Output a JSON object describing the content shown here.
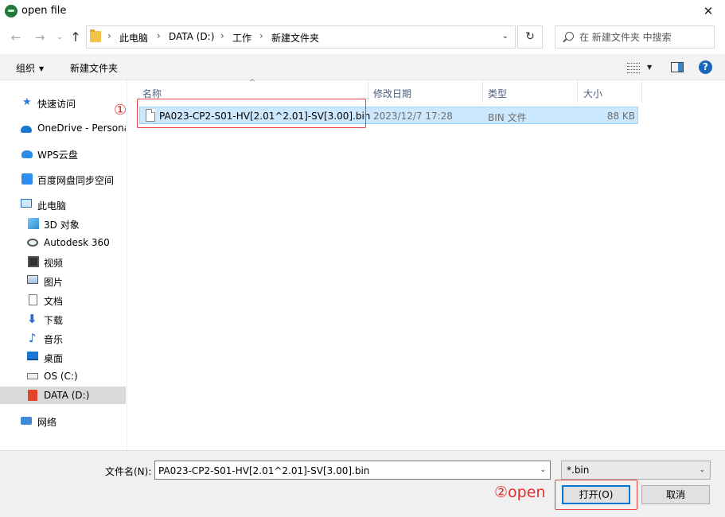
{
  "window": {
    "title": "open file"
  },
  "nav": {
    "back": "←",
    "forward": "→",
    "recent": "⌄",
    "up": "↑"
  },
  "address": {
    "crumbs": [
      "此电脑",
      "DATA (D:)",
      "工作",
      "新建文件夹"
    ],
    "sep": "›",
    "dropdown": "⌄"
  },
  "refresh": "↻",
  "search": {
    "placeholder": "在 新建文件夹 中搜索"
  },
  "toolbar": {
    "organize": "组织",
    "organize_caret": "▼",
    "new_folder": "新建文件夹",
    "view_caret": "▼",
    "help": "?"
  },
  "sidebar": {
    "items": [
      {
        "label": "快速访问"
      },
      {
        "label": "OneDrive - Persona"
      },
      {
        "label": "WPS云盘"
      },
      {
        "label": "百度网盘同步空间"
      },
      {
        "label": "此电脑"
      },
      {
        "label": "3D 对象"
      },
      {
        "label": "Autodesk 360"
      },
      {
        "label": "视频"
      },
      {
        "label": "图片"
      },
      {
        "label": "文档"
      },
      {
        "label": "下载"
      },
      {
        "label": "音乐"
      },
      {
        "label": "桌面"
      },
      {
        "label": "OS (C:)"
      },
      {
        "label": "DATA (D:)"
      },
      {
        "label": "网络"
      }
    ],
    "star": "★",
    "down_arrow": "⬇",
    "note": "♪"
  },
  "columns": {
    "name": "名称",
    "modified": "修改日期",
    "type": "类型",
    "size": "大小",
    "sort_arrow": "^"
  },
  "files": [
    {
      "name": "PA023-CP2-S01-HV[2.01^2.01]-SV[3.00].bin",
      "modified": "2023/12/7 17:28",
      "type": "BIN 文件",
      "size": "88 KB"
    }
  ],
  "annotations": {
    "step1": "①",
    "step2": "②open"
  },
  "footer": {
    "filename_label": "文件名(N):",
    "filename_value": "PA023-CP2-S01-HV[2.01^2.01]-SV[3.00].bin",
    "filename_caret": "⌄",
    "filter_value": "*.bin",
    "filter_caret": "⌄",
    "open_label": "打开(O)",
    "cancel_label": "取消"
  },
  "colors": {
    "selection": "#cce8ff",
    "annotation": "#e23030",
    "accent": "#0078d7"
  }
}
